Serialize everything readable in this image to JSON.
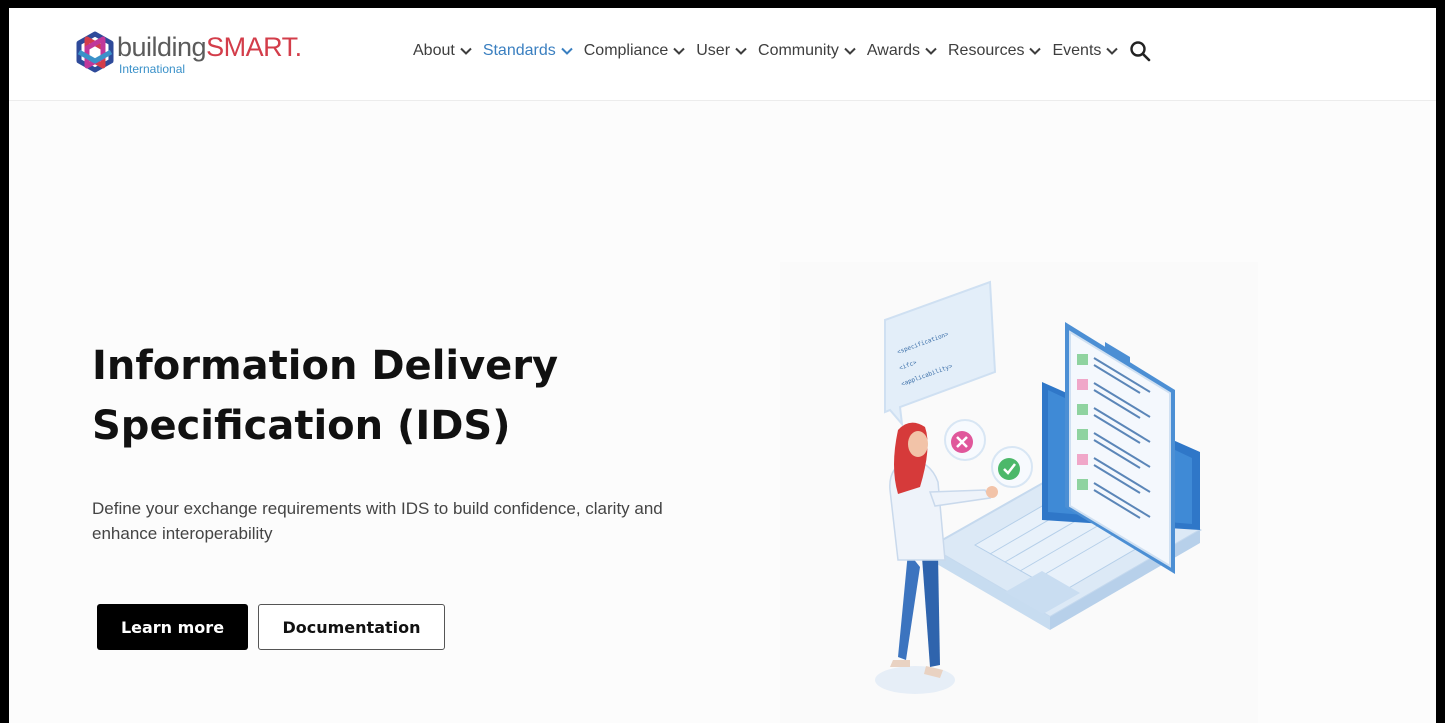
{
  "brand": {
    "name_part1": "building",
    "name_part2": "SMART",
    "trademark": ".",
    "subtitle": "International",
    "logo_icon": "interlocking-cube-logo-icon"
  },
  "nav": {
    "items": [
      {
        "label": "About",
        "active": false
      },
      {
        "label": "Standards",
        "active": true
      },
      {
        "label": "Compliance",
        "active": false
      },
      {
        "label": "User",
        "active": false
      },
      {
        "label": "Community",
        "active": false
      },
      {
        "label": "Awards",
        "active": false
      },
      {
        "label": "Resources",
        "active": false
      },
      {
        "label": "Events",
        "active": false
      }
    ],
    "search_icon": "search-icon"
  },
  "hero": {
    "title_line1": "Information Delivery",
    "title_line2": "Specification (IDS)",
    "description": "Define your exchange requirements with IDS to build confidence, clarity and enhance interoperability",
    "primary_button": "Learn more",
    "secondary_button": "Documentation"
  },
  "illustration": {
    "icon": "ids-checklist-illustration",
    "bubble_lines": [
      "<specification>",
      "<ifc>",
      "<applicability>"
    ]
  },
  "colors": {
    "accent_blue": "#3a7fc0",
    "brand_red": "#d33d4a",
    "text_dark": "#111111"
  }
}
